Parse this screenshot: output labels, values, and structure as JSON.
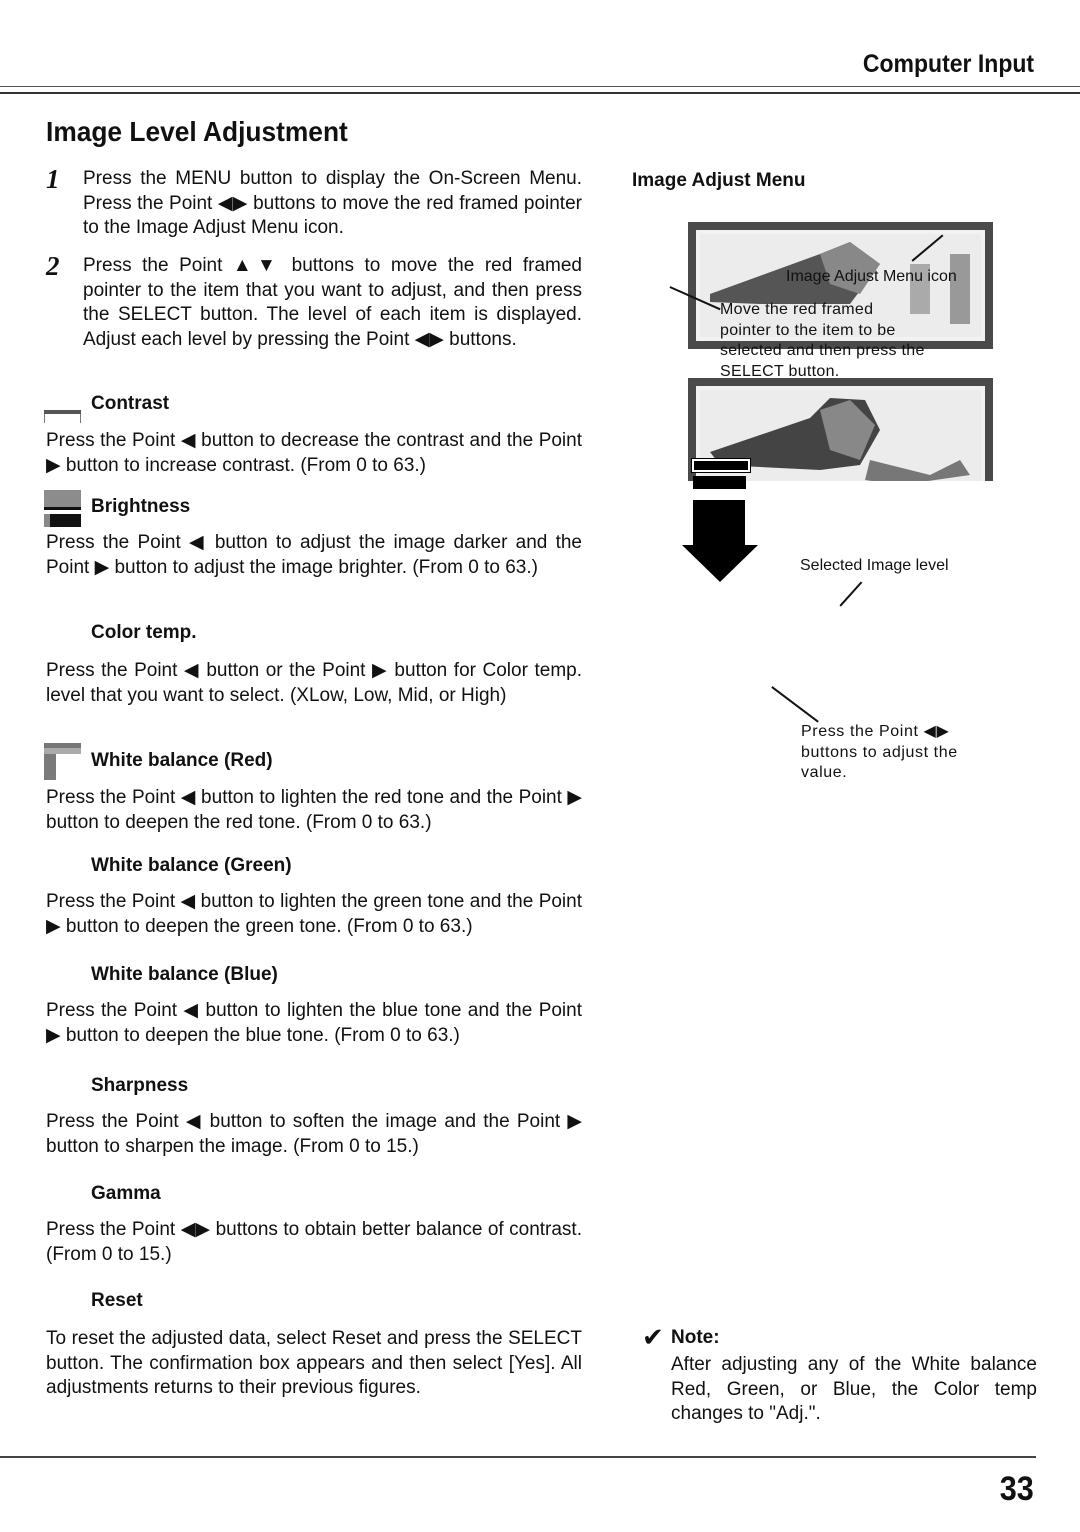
{
  "header": {
    "section": "Computer Input",
    "title": "Image Level Adjustment"
  },
  "steps": [
    {
      "number": "1",
      "text": "Press the MENU button to display the On-Screen Menu.  Press the Point ◀▶ buttons to move the red framed pointer to the Image Adjust Menu icon."
    },
    {
      "number": "2",
      "text": "Press the Point ▲▼ buttons to move the red framed pointer to the item that you want to adjust, and then press the SELECT button.  The level of each item is displayed.  Adjust each level by pressing the Point ◀▶ buttons."
    }
  ],
  "items": [
    {
      "title": "Contrast",
      "icon": "contrast-icon",
      "text": "Press the Point ◀ button to decrease the contrast and the Point ▶ button to increase contrast. (From 0 to 63.)"
    },
    {
      "title": "Brightness",
      "icon": "brightness-icon",
      "text": "Press the Point ◀ button to adjust the image darker and the Point ▶ button to adjust the image brighter. (From 0 to 63.)"
    },
    {
      "title": "Color temp.",
      "icon": "",
      "text": "Press the Point ◀ button or the Point ▶ button for Color temp. level that you want to select. (XLow, Low, Mid, or High)"
    },
    {
      "title": "White balance (Red)",
      "icon": "white-balance-red-icon",
      "text": "Press the Point ◀ button to lighten the red tone and the Point ▶ button to deepen the red tone. (From 0 to 63.)"
    },
    {
      "title": "White balance (Green)",
      "icon": "",
      "text": "Press the Point ◀ button to lighten the green tone and the Point ▶ button to deepen the green tone. (From 0 to 63.)"
    },
    {
      "title": "White balance (Blue)",
      "icon": "",
      "text": "Press the Point ◀ button to lighten the blue tone and the Point ▶ button to deepen the blue tone. (From 0 to 63.)"
    },
    {
      "title": "Sharpness",
      "icon": "",
      "text": "Press the Point ◀ button to soften the image and the Point ▶ button to sharpen the image. (From 0 to 15.)"
    },
    {
      "title": "Gamma",
      "icon": "",
      "text": "Press the Point ◀▶ buttons to obtain better balance of contrast. (From 0 to 15.)"
    },
    {
      "title": "Reset",
      "icon": "",
      "text": "To reset the adjusted data, select Reset and press the SELECT button.  The confirmation box appears and then select [Yes].  All adjustments returns to their previous figures."
    }
  ],
  "figure": {
    "title": "Image Adjust Menu",
    "callouts": {
      "menu_icon": "Image Adjust Menu icon",
      "move_pointer": "Move the red framed pointer to the item to be selected and then press the SELECT button.",
      "selected_level": "Selected Image level",
      "press_point": "Press the Point ◀▶ buttons to adjust the value."
    }
  },
  "note": {
    "label": "Note:",
    "text": "After adjusting any of the White balance Red, Green, or Blue, the Color temp changes to \"Adj.\"."
  },
  "footer": {
    "page_number": "33"
  }
}
